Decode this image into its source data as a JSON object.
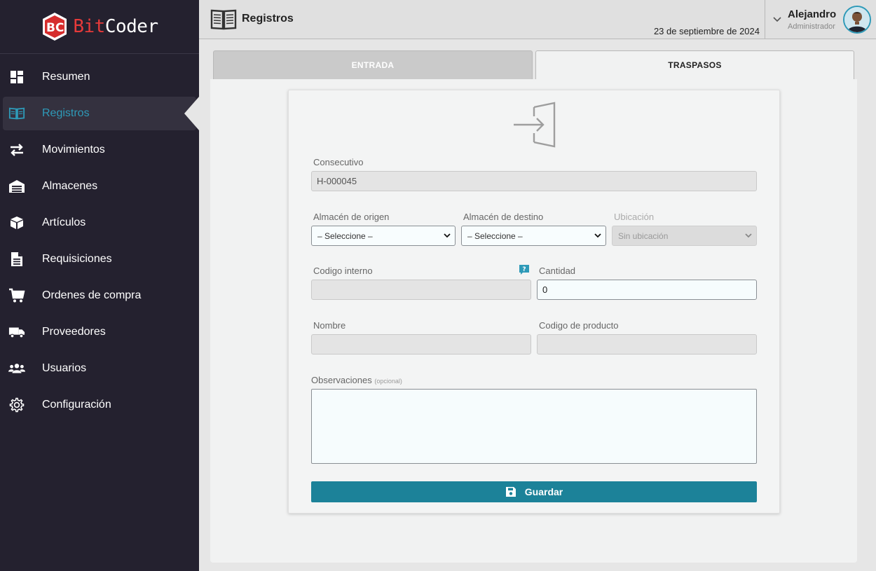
{
  "app": {
    "logo_bit": "Bit",
    "logo_coder": "Coder"
  },
  "sidebar": {
    "items": [
      {
        "label": "Resumen",
        "icon": "dashboard-icon"
      },
      {
        "label": "Registros",
        "icon": "book-icon",
        "active": true
      },
      {
        "label": "Movimientos",
        "icon": "exchange-arrows-icon"
      },
      {
        "label": "Almacenes",
        "icon": "warehouse-icon"
      },
      {
        "label": "Artículos",
        "icon": "box-icon"
      },
      {
        "label": "Requisiciones",
        "icon": "document-icon"
      },
      {
        "label": "Ordenes de compra",
        "icon": "cart-icon"
      },
      {
        "label": "Proveedores",
        "icon": "truck-icon"
      },
      {
        "label": "Usuarios",
        "icon": "users-icon"
      },
      {
        "label": "Configuración",
        "icon": "gear-icon"
      }
    ]
  },
  "header": {
    "title": "Registros",
    "date": "23 de septiembre de 2024",
    "user_name": "Alejandro",
    "user_role": "Administrador"
  },
  "tabs": [
    {
      "label": "ENTRADA",
      "active": false
    },
    {
      "label": "TRASPASOS",
      "active": true
    }
  ],
  "form": {
    "consecutivo_label": "Consecutivo",
    "consecutivo_value": "H-000045",
    "origen_label": "Almacén de origen",
    "origen_value": "– Seleccione –",
    "destino_label": "Almacén de destino",
    "destino_value": "– Seleccione –",
    "ubicacion_label": "Ubicación",
    "ubicacion_value": "Sin ubicación",
    "codigo_interno_label": "Codigo interno",
    "codigo_interno_value": "",
    "cantidad_label": "Cantidad",
    "cantidad_value": "0",
    "nombre_label": "Nombre",
    "nombre_value": "",
    "codigo_producto_label": "Codigo de producto",
    "codigo_producto_value": "",
    "observaciones_label": "Observaciones",
    "observaciones_optional": "(opcional)",
    "save_label": "Guardar"
  },
  "colors": {
    "sidebar_bg": "#24212f",
    "accent": "#2e9ab8",
    "button": "#1c8299",
    "logo_red": "#e63a3a"
  }
}
